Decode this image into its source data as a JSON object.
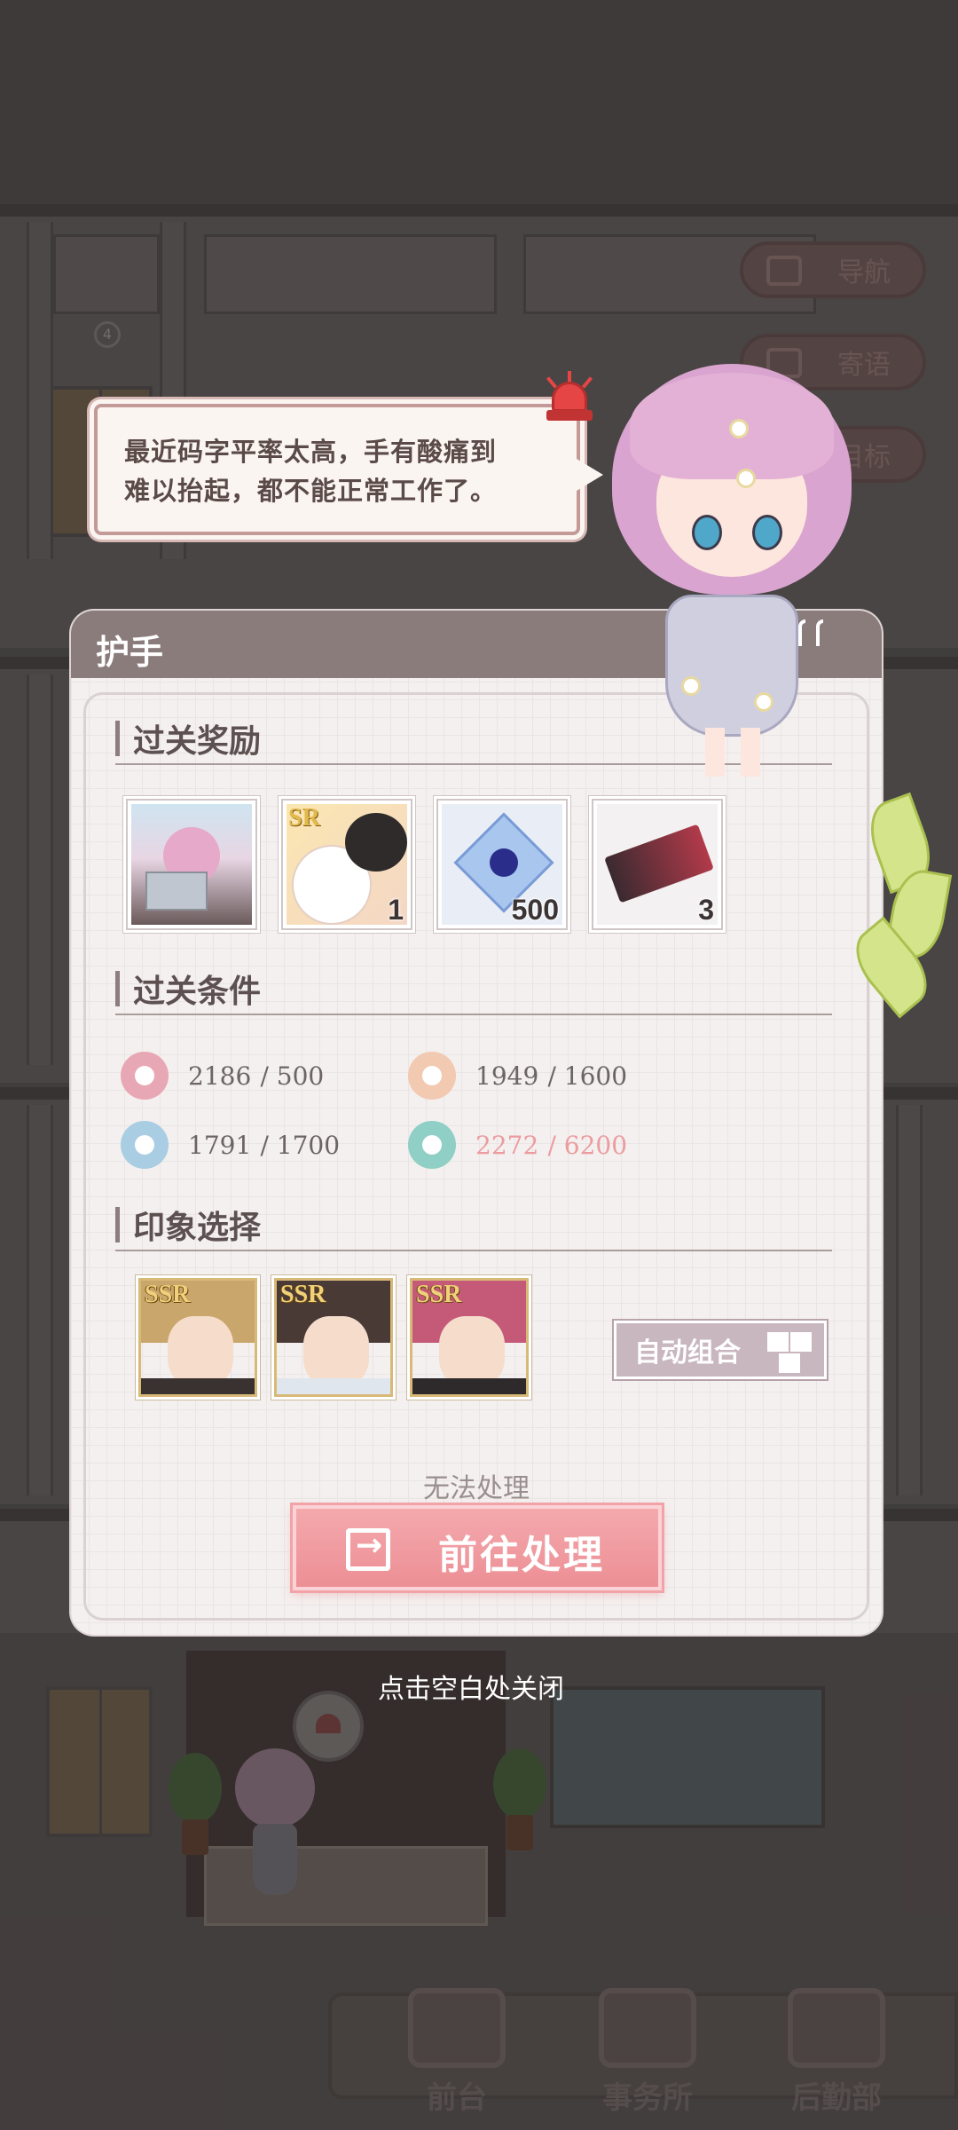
{
  "background": {
    "top_buttons": [
      {
        "label": "导航",
        "icon": "map-icon"
      },
      {
        "label": "寄语",
        "icon": "letter-icon"
      },
      {
        "label": "目标",
        "icon": "target-icon"
      }
    ],
    "floor_number": "4",
    "bottom_nav": [
      {
        "label": "前台",
        "icon": "reception-icon"
      },
      {
        "label": "事务所",
        "icon": "office-icon"
      },
      {
        "label": "后勤部",
        "icon": "logistics-icon"
      }
    ]
  },
  "speech": {
    "line1": "最近码字平率太高，手有酸痛到",
    "line2": "难以抬起，都不能正常工作了。"
  },
  "panel": {
    "title": "护手",
    "rewards_heading": "过关奖励",
    "rewards": [
      {
        "name": "photo-card",
        "qty": ""
      },
      {
        "name": "sr-cat-card",
        "badge": "SR",
        "qty": "1"
      },
      {
        "name": "crystal-flower",
        "qty": "500"
      },
      {
        "name": "red-ticket",
        "qty": "3"
      }
    ],
    "conditions_heading": "过关条件",
    "conditions": [
      {
        "icon": "dumbbell-icon",
        "color": "#e8a7b5",
        "current": "2186",
        "required": "/ 500",
        "met": true
      },
      {
        "icon": "person-icon",
        "color": "#f2c9b1",
        "current": "1949",
        "required": "/ 1600",
        "met": true
      },
      {
        "icon": "graduation-cap-icon",
        "color": "#a9cde3",
        "current": "1791",
        "required": "/ 1700",
        "met": true
      },
      {
        "icon": "flower-icon",
        "color": "#8fcfc5",
        "current": "2272",
        "required": "/ 6200",
        "met": false
      }
    ],
    "impression_heading": "印象选择",
    "impressions": [
      {
        "badge": "SSR",
        "hair": "#c9a66b",
        "clothes": "#3a3230"
      },
      {
        "badge": "SSR",
        "hair": "#4a3a36",
        "clothes": "#dfe6ee"
      },
      {
        "badge": "SSR",
        "hair": "#c45a78",
        "clothes": "#2e2a2c"
      }
    ],
    "auto_combine_label": "自动组合",
    "cannot_process": "无法处理",
    "go_button_label": "前往处理"
  },
  "close_hint": "点击空白处关闭",
  "colors": {
    "accent_pink": "#ec8f95",
    "header": "#8b7c7c",
    "unmet": "#ec9b9f"
  }
}
